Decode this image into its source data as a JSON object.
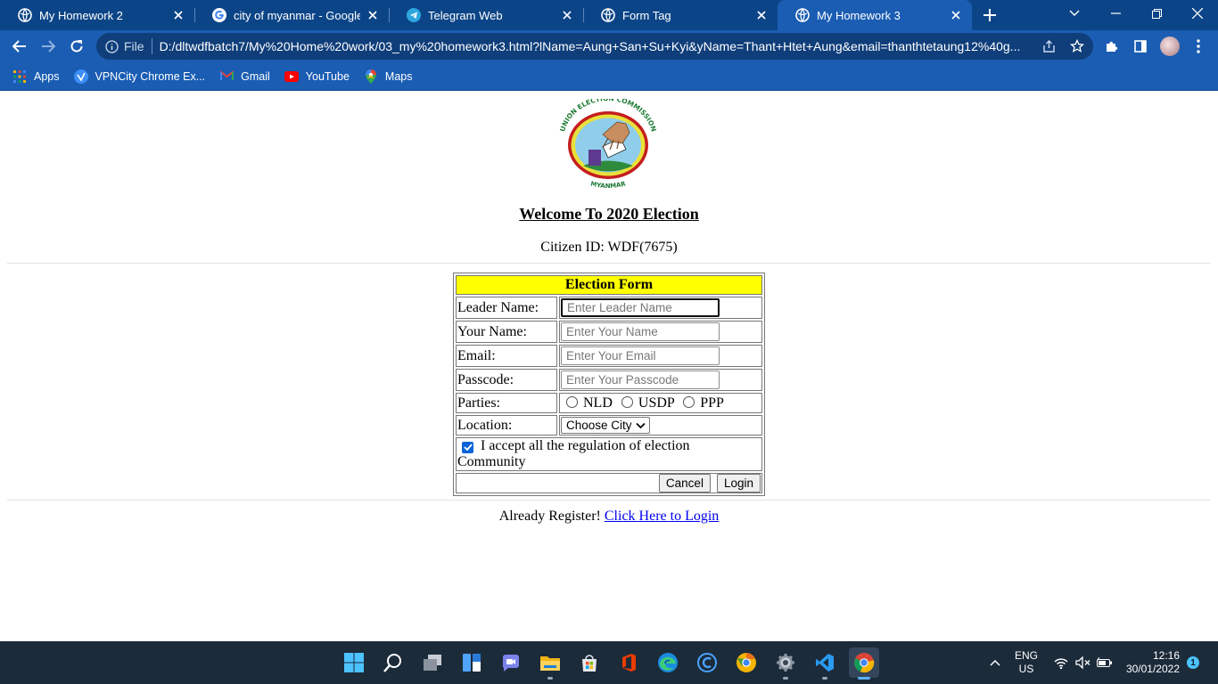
{
  "browser": {
    "tabs": [
      {
        "title": "My Homework 2",
        "icon": "globe-icon",
        "active": false
      },
      {
        "title": "city of myanmar - Google Se",
        "icon": "google-icon",
        "active": false
      },
      {
        "title": "Telegram Web",
        "icon": "telegram-icon",
        "active": false
      },
      {
        "title": "Form Tag",
        "icon": "globe-icon",
        "active": false
      },
      {
        "title": "My Homework 3",
        "icon": "globe-icon",
        "active": true
      }
    ],
    "address": {
      "scheme_label": "File",
      "url": "D:/dltwdfbatch7/My%20Home%20work/03_my%20homework3.html?lName=Aung+San+Su+Kyi&yName=Thant+Htet+Aung&email=thanthtetaung12%40g..."
    },
    "bookmarks": [
      {
        "label": "Apps",
        "icon": "apps-grid-icon"
      },
      {
        "label": "VPNCity Chrome Ex...",
        "icon": "vpncity-icon"
      },
      {
        "label": "Gmail",
        "icon": "gmail-icon"
      },
      {
        "label": "YouTube",
        "icon": "youtube-icon"
      },
      {
        "label": "Maps",
        "icon": "maps-icon"
      }
    ]
  },
  "page": {
    "logo": {
      "arc_text_top": "UNION ELECTION COMMISSION",
      "arc_text_bottom": "MYANMAR"
    },
    "heading": "Welcome To 2020 Election",
    "citizen_id": "Citizen ID: WDF(7675)",
    "form": {
      "title": "Election Form",
      "leader_label": "Leader Name:",
      "leader_placeholder": "Enter Leader Name",
      "your_name_label": "Your Name:",
      "your_name_placeholder": "Enter Your Name",
      "email_label": "Email:",
      "email_placeholder": "Enter Your Email",
      "passcode_label": "Passcode:",
      "passcode_placeholder": "Enter Your Passcode",
      "parties_label": "Parties:",
      "parties": [
        "NLD",
        "USDP",
        "PPP"
      ],
      "location_label": "Location:",
      "location_selected": "Choose City",
      "accept_text": "I accept all the regulation of election Community",
      "accept_checked": true,
      "cancel_label": "Cancel",
      "login_label": "Login"
    },
    "register_text": "Already Register!",
    "login_link": "Click Here to Login"
  },
  "taskbar": {
    "apps": [
      "windows-start-icon",
      "search-icon",
      "task-view-icon",
      "widgets-icon",
      "teams-chat-icon",
      "file-explorer-icon",
      "microsoft-store-icon",
      "office-icon",
      "edge-icon",
      "ccleaner-icon",
      "chrome-canary-icon",
      "settings-icon",
      "vscode-icon",
      "chrome-icon"
    ],
    "language": "ENG",
    "region": "US",
    "time": "12:16",
    "date": "30/01/2022",
    "notifications": "1"
  },
  "colors": {
    "tabstrip": "#0c4587",
    "toolbar": "#1a5db3",
    "form_header": "#ffff00",
    "link": "#0000ee",
    "taskbar": "#1c2b3a"
  }
}
